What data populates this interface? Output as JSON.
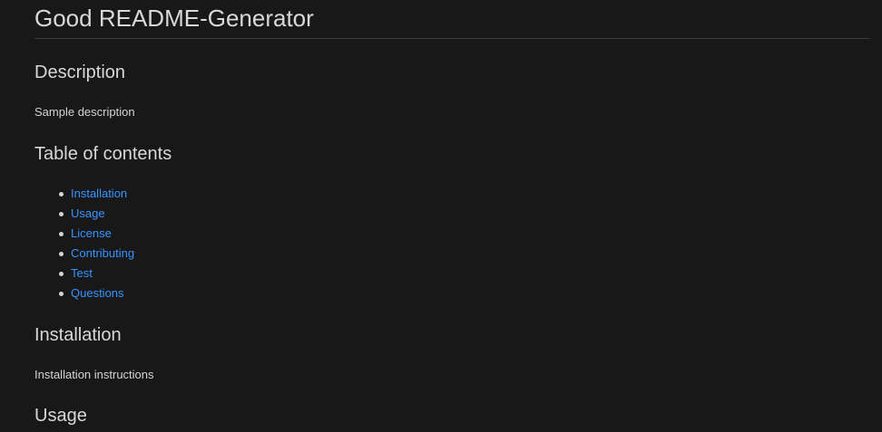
{
  "title": "Good README-Generator",
  "sections": {
    "description": {
      "heading": "Description",
      "text": "Sample description"
    },
    "toc": {
      "heading": "Table of contents",
      "items": [
        "Installation",
        "Usage",
        "License",
        "Contributing",
        "Test",
        "Questions"
      ]
    },
    "installation": {
      "heading": "Installation",
      "text": "Installation instructions"
    },
    "usage": {
      "heading": "Usage"
    }
  },
  "colors": {
    "background": "#181818",
    "text": "#d4d4d4",
    "link": "#3794ff",
    "divider": "#3a3a3a"
  }
}
